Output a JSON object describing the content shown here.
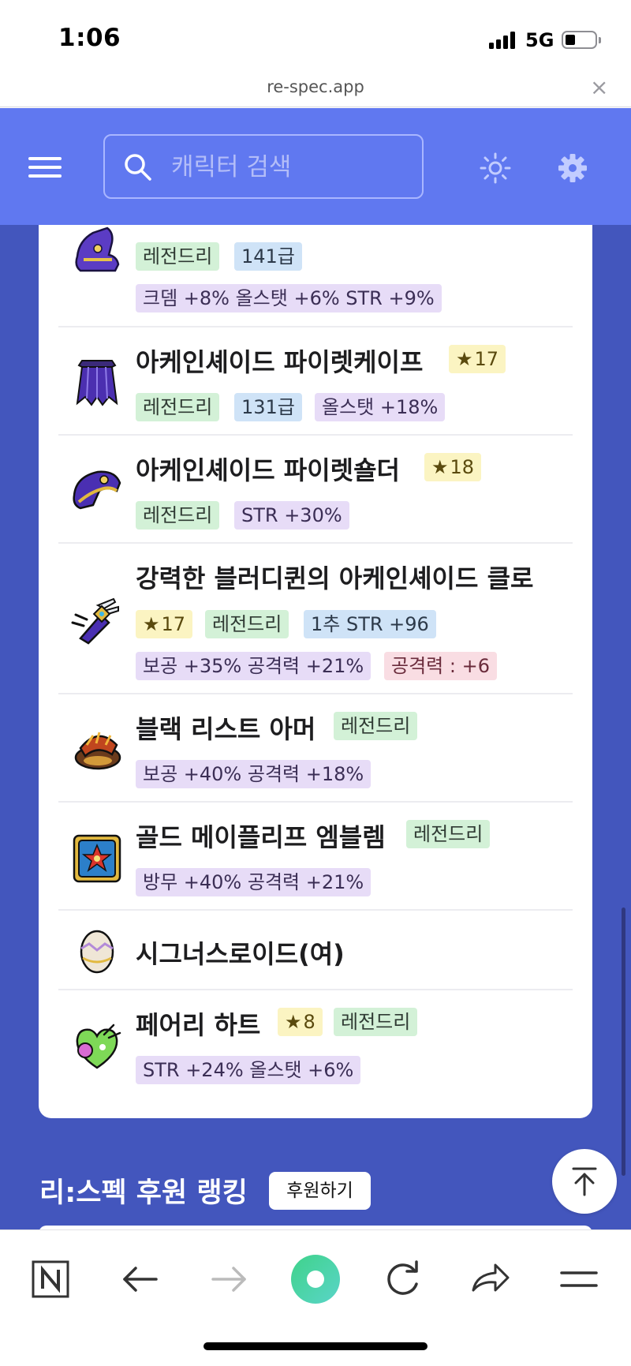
{
  "status_bar": {
    "time": "1:06",
    "network": "5G"
  },
  "browser": {
    "url": "re-spec.app",
    "close_symbol": "×"
  },
  "header": {
    "menu_icon": "hamburger-icon",
    "search": {
      "placeholder": "캐릭터 검색",
      "icon": "search-icon"
    },
    "theme_icon": "sun-icon",
    "settings_icon": "gear-icon",
    "accent": "#6078f0"
  },
  "equipment": [
    {
      "name": "",
      "icon": "purple-boots-icon",
      "tags": [
        {
          "text": "레전드리",
          "color": "green"
        },
        {
          "text": "141급",
          "color": "blue"
        }
      ],
      "options": [
        {
          "text": "크뎀 +8% 올스탯 +6% STR +9%",
          "color": "purple"
        }
      ]
    },
    {
      "name": "아케인셰이드 파이렛케이프",
      "icon": "cape-icon",
      "tags": [
        {
          "text": "17",
          "color": "yellow",
          "star": true
        }
      ],
      "options": [
        {
          "text": "레전드리",
          "color": "green"
        },
        {
          "text": "131급",
          "color": "blue"
        },
        {
          "text": "올스탯 +18%",
          "color": "purple"
        }
      ]
    },
    {
      "name": "아케인셰이드 파이렛숄더",
      "icon": "shoulder-icon",
      "tags": [
        {
          "text": "18",
          "color": "yellow",
          "star": true
        }
      ],
      "options": [
        {
          "text": "레전드리",
          "color": "green"
        },
        {
          "text": "STR +30%",
          "color": "purple"
        }
      ]
    },
    {
      "name": "강력한 블러디퀸의 아케인셰이드 클로",
      "icon": "claw-icon",
      "tags": [
        {
          "text": "17",
          "color": "yellow",
          "star": true
        },
        {
          "text": "레전드리",
          "color": "green"
        },
        {
          "text": "1추 STR +96",
          "color": "blue"
        }
      ],
      "options": [
        {
          "text": "보공 +35% 공격력 +21%",
          "color": "purple"
        },
        {
          "text": "공격력 : +6",
          "color": "pink"
        }
      ]
    },
    {
      "name": "블랙 리스트 아머",
      "icon": "armor-icon",
      "tags": [
        {
          "text": "레전드리",
          "color": "green"
        }
      ],
      "options": [
        {
          "text": "보공 +40% 공격력 +18%",
          "color": "purple"
        }
      ]
    },
    {
      "name": "골드 메이플리프 엠블렘",
      "icon": "emblem-icon",
      "tags": [
        {
          "text": "레전드리",
          "color": "green"
        }
      ],
      "options": [
        {
          "text": "방무 +40% 공격력 +21%",
          "color": "purple"
        }
      ]
    },
    {
      "name": "시그너스로이드(여)",
      "icon": "egg-icon",
      "tags": [],
      "options": []
    },
    {
      "name": "페어리 하트",
      "icon": "fairy-heart-icon",
      "tags": [
        {
          "text": "8",
          "color": "yellow",
          "star": true
        },
        {
          "text": "레전드리",
          "color": "green"
        }
      ],
      "options": [
        {
          "text": "STR +24% 올스탯 +6%",
          "color": "purple"
        }
      ]
    }
  ],
  "ranking": {
    "title": "리:스펙 후원 랭킹",
    "donate_label": "후원하기"
  },
  "toolbar": {
    "icons": [
      "naver-n-icon",
      "back-arrow-icon",
      "forward-arrow-icon",
      "green-circle-home-icon",
      "reload-icon",
      "share-icon",
      "menu-lines-icon"
    ]
  }
}
